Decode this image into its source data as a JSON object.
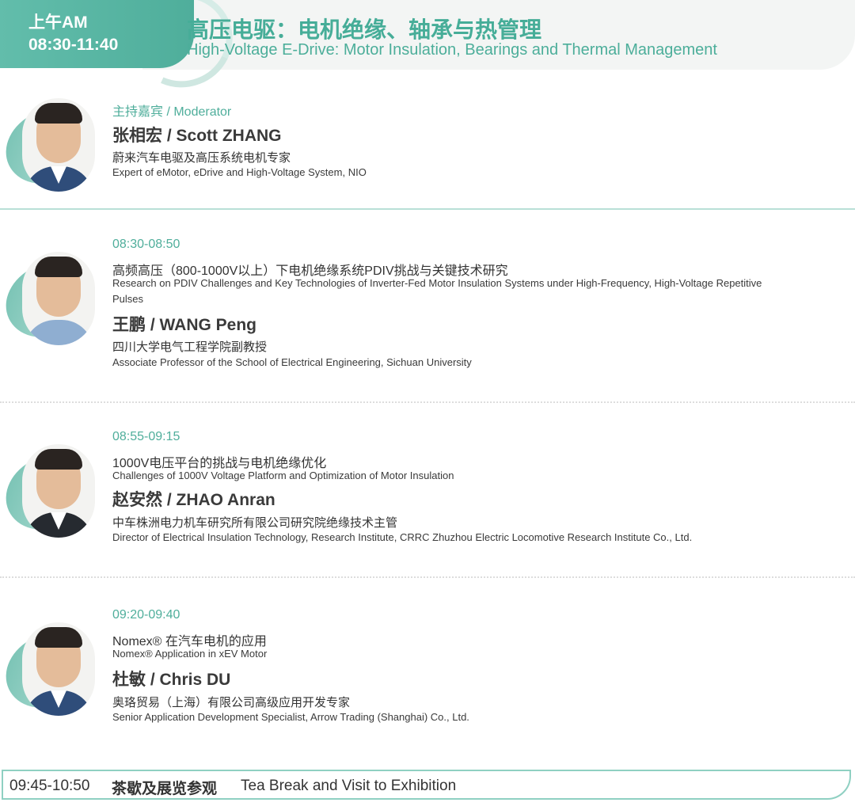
{
  "header": {
    "period": "上午AM",
    "time_range": "08:30-11:40",
    "title_cn": "高压电驱：电机绝缘、轴承与热管理",
    "title_en": "High-Voltage E-Drive: Motor Insulation, Bearings and Thermal Management"
  },
  "moderator": {
    "label": "主持嘉宾 / Moderator",
    "name": "张相宏 / Scott ZHANG",
    "affiliation_cn": "蔚来汽车电驱及高压系统电机专家",
    "affiliation_en": "Expert of eMotor, eDrive and High-Voltage System, NIO",
    "avatar_icon": "speaker-photo"
  },
  "talks": [
    {
      "time": "08:30-08:50",
      "topic_cn": "高频高压（800-1000V以上）下电机绝缘系统PDIV挑战与关键技术研究",
      "topic_en": "Research on PDIV Challenges and Key Technologies of Inverter-Fed Motor Insulation Systems under High-Frequency, High-Voltage Repetitive Pulses",
      "name": "王鹏 / WANG Peng",
      "affiliation_cn": "四川大学电气工程学院副教授",
      "affiliation_en": "Associate Professor of the School of Electrical Engineering, Sichuan University",
      "avatar_icon": "speaker-photo"
    },
    {
      "time": "08:55-09:15",
      "topic_cn": "1000V电压平台的挑战与电机绝缘优化",
      "topic_en": "Challenges of 1000V Voltage Platform and Optimization of Motor Insulation",
      "name": "赵安然 / ZHAO Anran",
      "affiliation_cn": "中车株洲电力机车研究所有限公司研究院绝缘技术主管",
      "affiliation_en": "Director of Electrical Insulation Technology, Research Institute, CRRC Zhuzhou Electric Locomotive Research Institute Co., Ltd.",
      "avatar_icon": "speaker-photo"
    },
    {
      "time": "09:20-09:40",
      "topic_cn": "Nomex® 在汽车电机的应用",
      "topic_en": "Nomex® Application in xEV Motor",
      "name": "杜敏 / Chris DU",
      "affiliation_cn": "奥珞贸易（上海）有限公司高级应用开发专家",
      "affiliation_en": "Senior Application Development Specialist, Arrow Trading (Shanghai) Co., Ltd.",
      "avatar_icon": "speaker-photo"
    }
  ],
  "break": {
    "time": "09:45-10:50",
    "label_cn": "茶歇及展览参观",
    "label_en": "Tea Break and Visit to Exhibition"
  },
  "colors": {
    "accent": "#4fae9b",
    "accent_light": "#b9e0d7",
    "text": "#333333"
  }
}
